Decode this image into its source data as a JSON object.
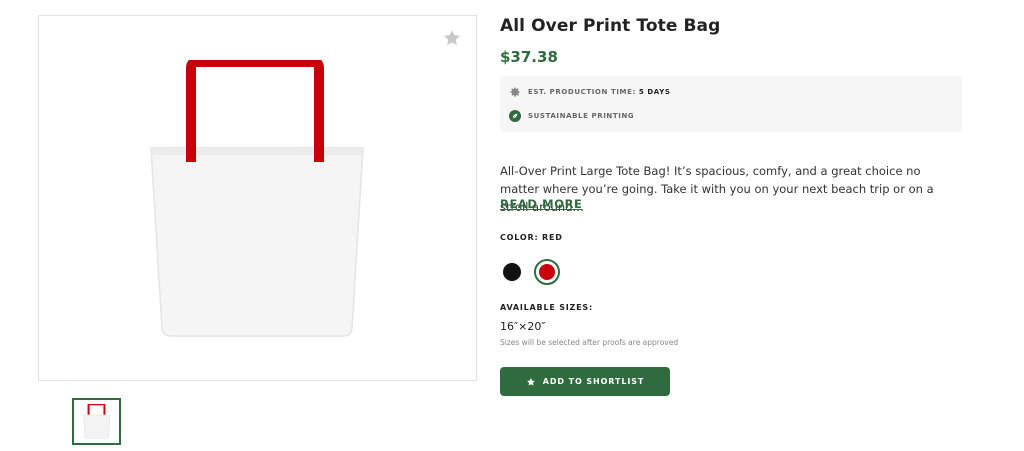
{
  "product": {
    "title": "All Over Print Tote Bag",
    "price": "$37.38",
    "production_label": "EST. PRODUCTION TIME:",
    "production_value": "5 DAYS",
    "sustainable_label": "SUSTAINABLE PRINTING",
    "description": "All-Over Print Large Tote Bag! It’s spacious, comfy, and a great choice no matter where you’re going. Take it with you on your next beach trip or on a stroll around…",
    "read_more": "READ MORE",
    "color_label": "COLOR: RED",
    "colors": [
      {
        "name": "black",
        "hex": "#111111",
        "selected": false
      },
      {
        "name": "red",
        "hex": "#c8000a",
        "selected": true
      }
    ],
    "sizes_label": "AVAILABLE SIZES:",
    "size_value": "16″×20″",
    "size_note": "Sizes will be selected after proofs are approved",
    "cta_label": "ADD TO SHORTLIST"
  },
  "theme": {
    "accent": "#2f6b3c",
    "bag_handle": "#c8000a"
  },
  "icons": [
    "star-icon",
    "gear-icon",
    "leaf-icon"
  ]
}
